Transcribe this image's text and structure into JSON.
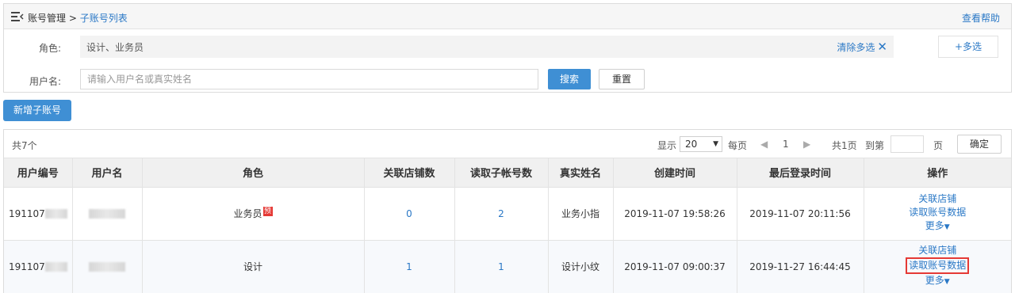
{
  "breadcrumb": {
    "parent": "账号管理 > ",
    "current": "子账号列表"
  },
  "help_link": "查看帮助",
  "filters": {
    "role_label": "角色:",
    "role_value": "设计、业务员",
    "clear_label": "清除多选",
    "multi_label": "+多选",
    "username_label": "用户名:",
    "username_placeholder": "请输入用户名或真实姓名",
    "search_label": "搜索",
    "reset_label": "重置"
  },
  "add_button": "新增子账号",
  "pager": {
    "total": "共7个",
    "show": "显示",
    "page_size": "20",
    "per_page": "每页",
    "current_page": "1",
    "total_pages": "共1页",
    "goto": "到第",
    "page_unit": "页",
    "confirm": "确定"
  },
  "table": {
    "headers": [
      "用户编号",
      "用户名",
      "角色",
      "关联店铺数",
      "读取子帐号数",
      "真实姓名",
      "创建时间",
      "最后登录时间",
      "操作"
    ],
    "rows": [
      {
        "id": "191107",
        "role": "业务员",
        "role_tag": "预",
        "shops": "0",
        "subs": "2",
        "real_name": "业务小指",
        "created": "2019-11-07 19:58:26",
        "last_login": "2019-11-07 20:11:56"
      },
      {
        "id": "191107",
        "role": "设计",
        "role_tag": "",
        "shops": "1",
        "subs": "1",
        "real_name": "设计小纹",
        "created": "2019-11-07 09:00:37",
        "last_login": "2019-11-27 16:44:45"
      }
    ],
    "ops": {
      "link_shop": "关联店铺",
      "read_data": "读取账号数据",
      "more": "更多"
    }
  },
  "colors": {
    "accent": "#3f8fd4",
    "link": "#2a78c6",
    "highlight": "#e53935"
  }
}
